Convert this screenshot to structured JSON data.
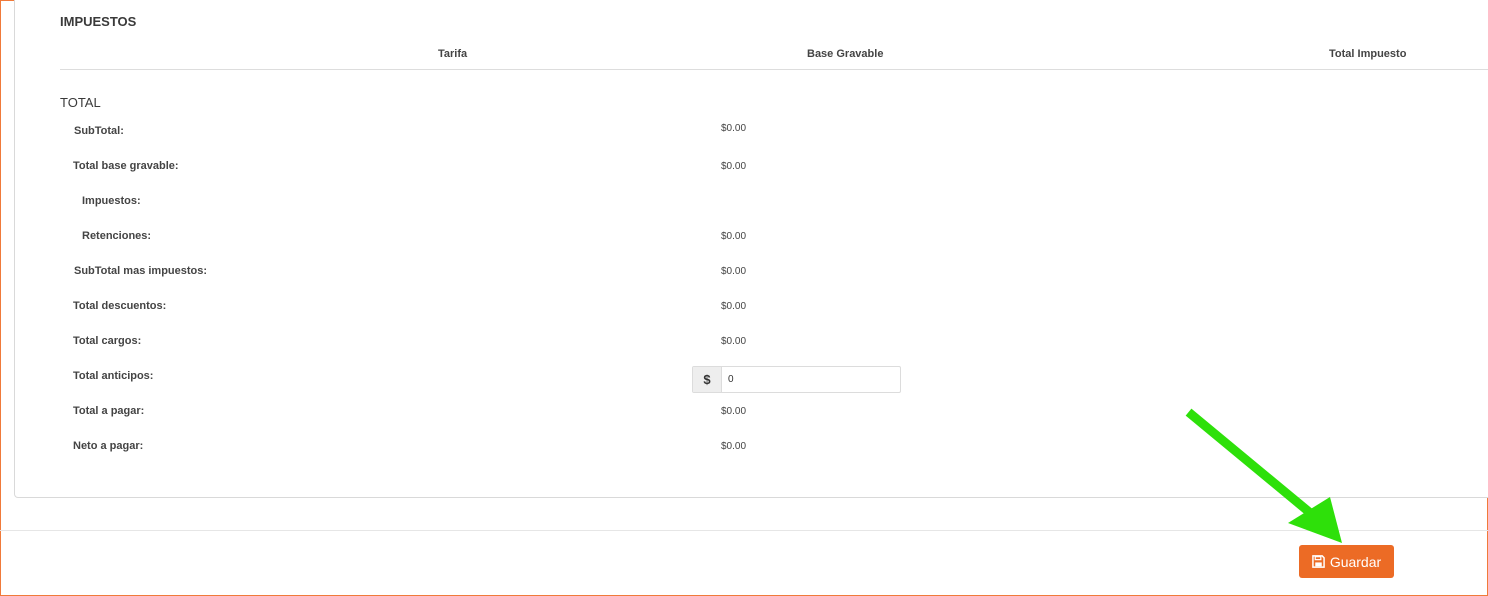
{
  "taxes": {
    "title": "IMPUESTOS",
    "columns": [
      "Tarifa",
      "Base Gravable",
      "Total Impuesto"
    ]
  },
  "totals": {
    "title": "TOTAL",
    "rows": [
      {
        "label": "SubTotal:",
        "value": "$0.00"
      },
      {
        "label": "Total base gravable:",
        "value": "$0.00"
      },
      {
        "label": "Impuestos:",
        "value": ""
      },
      {
        "label": "Retenciones:",
        "value": "$0.00"
      },
      {
        "label": "SubTotal mas impuestos:",
        "value": "$0.00"
      },
      {
        "label": "Total descuentos:",
        "value": "$0.00"
      },
      {
        "label": "Total cargos:",
        "value": "$0.00"
      },
      {
        "label": "Total anticipos:",
        "value": ""
      },
      {
        "label": "Total a pagar:",
        "value": "$0.00"
      },
      {
        "label": "Neto a pagar:",
        "value": "$0.00"
      }
    ],
    "anticipos_input": {
      "addon": "$",
      "value": "0"
    }
  },
  "footer": {
    "save_label": "Guardar",
    "save_icon": "floppy-disk-icon"
  },
  "colors": {
    "accent": "#ec6b25",
    "annotation_arrow": "#2ee00a",
    "frame_border": "#f07a3a"
  }
}
